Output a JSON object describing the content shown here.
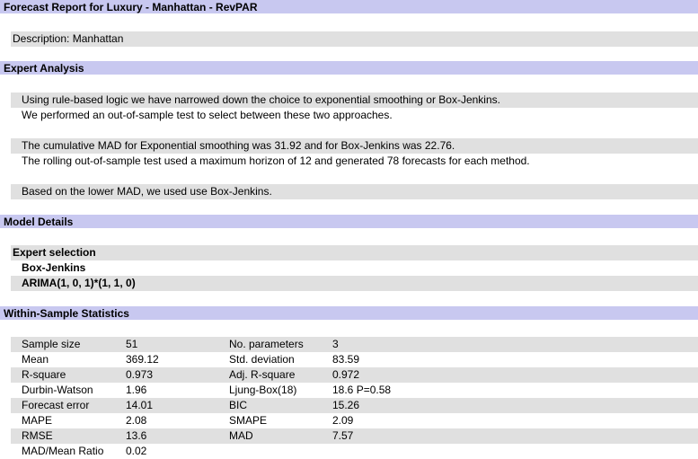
{
  "report": {
    "title": "Forecast Report for Luxury - Manhattan - RevPAR",
    "description": "Description: Manhattan"
  },
  "expert_analysis": {
    "header": "Expert Analysis",
    "lines": [
      "Using rule-based logic we have narrowed down the choice to exponential smoothing or Box-Jenkins.",
      "We performed an out-of-sample test to select between these two approaches.",
      "The cumulative MAD for Exponential smoothing was 31.92 and for Box-Jenkins was 22.76.",
      "The rolling out-of-sample test used a maximum horizon of 12 and generated 78 forecasts for each method.",
      "Based on the lower MAD, we used use Box-Jenkins."
    ]
  },
  "model_details": {
    "header": "Model Details",
    "selection_label": "Expert selection",
    "method": "Box-Jenkins",
    "model": "ARIMA(1, 0, 1)*(1, 1, 0)"
  },
  "stats": {
    "header": "Within-Sample Statistics",
    "rows": [
      {
        "l1": "Sample size",
        "v1": "51",
        "l2": "No. parameters",
        "v2": "3"
      },
      {
        "l1": "Mean",
        "v1": "369.12",
        "l2": "Std. deviation",
        "v2": "83.59"
      },
      {
        "l1": "R-square",
        "v1": "0.973",
        "l2": "Adj. R-square",
        "v2": "0.972"
      },
      {
        "l1": "Durbin-Watson",
        "v1": "1.96",
        "l2": "Ljung-Box(18)",
        "v2": "18.6 P=0.58"
      },
      {
        "l1": "Forecast error",
        "v1": "14.01",
        "l2": "BIC",
        "v2": "15.26"
      },
      {
        "l1": "MAPE",
        "v1": "2.08",
        "l2": "SMAPE",
        "v2": "2.09"
      },
      {
        "l1": "RMSE",
        "v1": "13.6",
        "l2": "MAD",
        "v2": "7.57"
      },
      {
        "l1": "MAD/Mean Ratio",
        "v1": "0.02",
        "l2": "",
        "v2": ""
      }
    ]
  }
}
